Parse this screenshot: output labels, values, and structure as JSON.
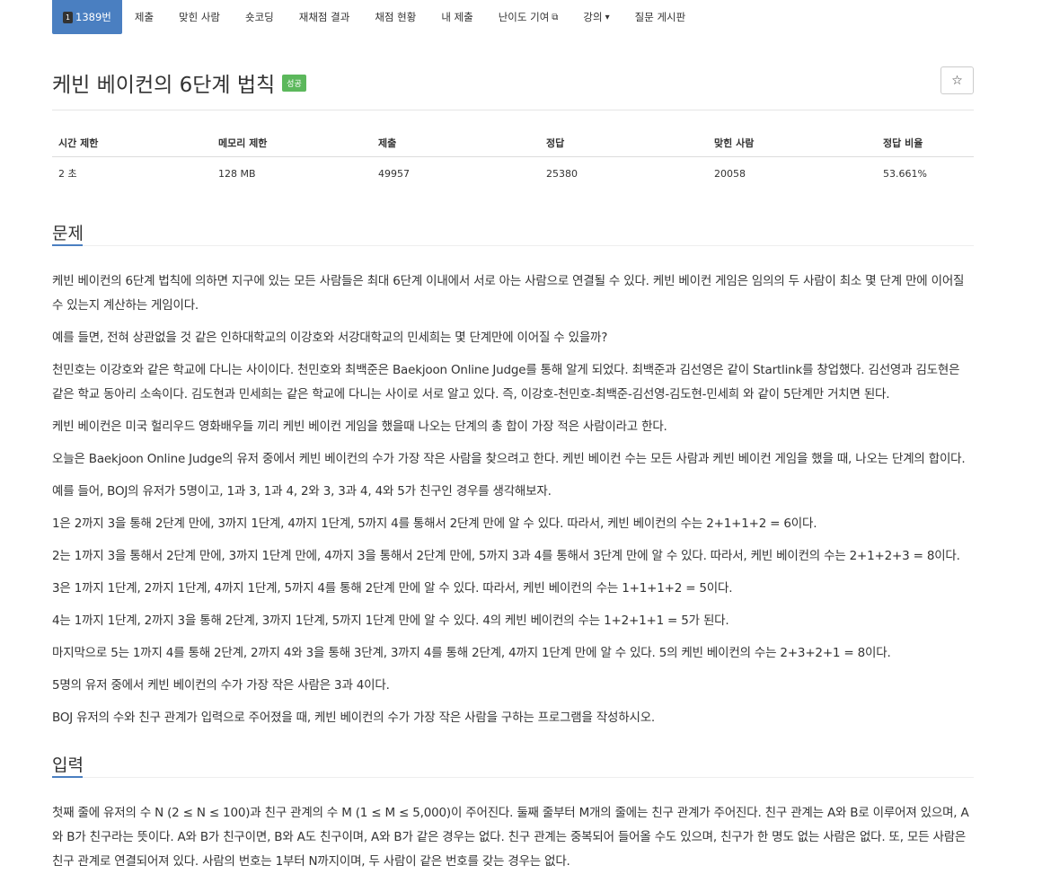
{
  "nav": {
    "problem_number": "1389번",
    "items": [
      "제출",
      "맞힌 사람",
      "숏코딩",
      "재채점 결과",
      "채점 현황",
      "내 제출",
      "난이도 기여",
      "강의",
      "질문 게시판"
    ]
  },
  "problem": {
    "title": "케빈 베이컨의 6단계 법칙",
    "badge": "성공",
    "star": "☆"
  },
  "stats": {
    "headers": [
      "시간 제한",
      "메모리 제한",
      "제출",
      "정답",
      "맞힌 사람",
      "정답 비율"
    ],
    "values": [
      "2 초",
      "128 MB",
      "49957",
      "25380",
      "20058",
      "53.661%"
    ]
  },
  "sections": {
    "problem_heading": "문제",
    "problem_paragraphs": [
      "케빈 베이컨의 6단계 법칙에 의하면 지구에 있는 모든 사람들은 최대 6단계 이내에서 서로 아는 사람으로 연결될 수 있다. 케빈 베이컨 게임은 임의의 두 사람이 최소 몇 단계 만에 이어질 수 있는지 계산하는 게임이다.",
      "예를 들면, 전혀 상관없을 것 같은 인하대학교의 이강호와 서강대학교의 민세희는 몇 단계만에 이어질 수 있을까?",
      "천민호는 이강호와 같은 학교에 다니는 사이이다. 천민호와 최백준은 Baekjoon Online Judge를 통해 알게 되었다. 최백준과 김선영은 같이 Startlink를 창업했다. 김선영과 김도현은 같은 학교 동아리 소속이다. 김도현과 민세희는 같은 학교에 다니는 사이로 서로 알고 있다. 즉, 이강호-천민호-최백준-김선영-김도현-민세희 와 같이 5단계만 거치면 된다.",
      "케빈 베이컨은 미국 헐리우드 영화배우들 끼리 케빈 베이컨 게임을 했을때 나오는 단계의 총 합이 가장 적은 사람이라고 한다.",
      "오늘은 Baekjoon Online Judge의 유저 중에서 케빈 베이컨의 수가 가장 작은 사람을 찾으려고 한다. 케빈 베이컨 수는 모든 사람과 케빈 베이컨 게임을 했을 때, 나오는 단계의 합이다.",
      "예를 들어, BOJ의 유저가 5명이고, 1과 3, 1과 4, 2와 3, 3과 4, 4와 5가 친구인 경우를 생각해보자.",
      "1은 2까지 3을 통해 2단계 만에, 3까지 1단계, 4까지 1단계, 5까지 4를 통해서 2단계 만에 알 수 있다. 따라서, 케빈 베이컨의 수는 2+1+1+2 = 6이다.",
      "2는 1까지 3을 통해서 2단계 만에, 3까지 1단계 만에, 4까지 3을 통해서 2단계 만에, 5까지 3과 4를 통해서 3단계 만에 알 수 있다. 따라서, 케빈 베이컨의 수는 2+1+2+3 = 8이다.",
      "3은 1까지 1단계, 2까지 1단계, 4까지 1단계, 5까지 4를 통해 2단계 만에 알 수 있다. 따라서, 케빈 베이컨의 수는 1+1+1+2 = 5이다.",
      "4는 1까지 1단계, 2까지 3을 통해 2단계, 3까지 1단계, 5까지 1단계 만에 알 수 있다. 4의 케빈 베이컨의 수는 1+2+1+1 = 5가 된다.",
      "마지막으로 5는 1까지 4를 통해 2단계, 2까지 4와 3을 통해 3단계, 3까지 4를 통해 2단계, 4까지 1단계 만에 알 수 있다. 5의 케빈 베이컨의 수는 2+3+2+1 = 8이다.",
      "5명의 유저 중에서 케빈 베이컨의 수가 가장 작은 사람은 3과 4이다.",
      "BOJ 유저의 수와 친구 관계가 입력으로 주어졌을 때, 케빈 베이컨의 수가 가장 작은 사람을 구하는 프로그램을 작성하시오."
    ],
    "input_heading": "입력",
    "input_text": "첫째 줄에 유저의 수 N (2 ≤ N ≤ 100)과 친구 관계의 수 M (1 ≤ M ≤ 5,000)이 주어진다. 둘째 줄부터 M개의 줄에는 친구 관계가 주어진다. 친구 관계는 A와 B로 이루어져 있으며, A와 B가 친구라는 뜻이다. A와 B가 친구이면, B와 A도 친구이며, A와 B가 같은 경우는 없다. 친구 관계는 중복되어 들어올 수도 있으며, 친구가 한 명도 없는 사람은 없다. 또, 모든 사람은 친구 관계로 연결되어져 있다. 사람의 번호는 1부터 N까지이며, 두 사람이 같은 번호를 갖는 경우는 없다."
  }
}
